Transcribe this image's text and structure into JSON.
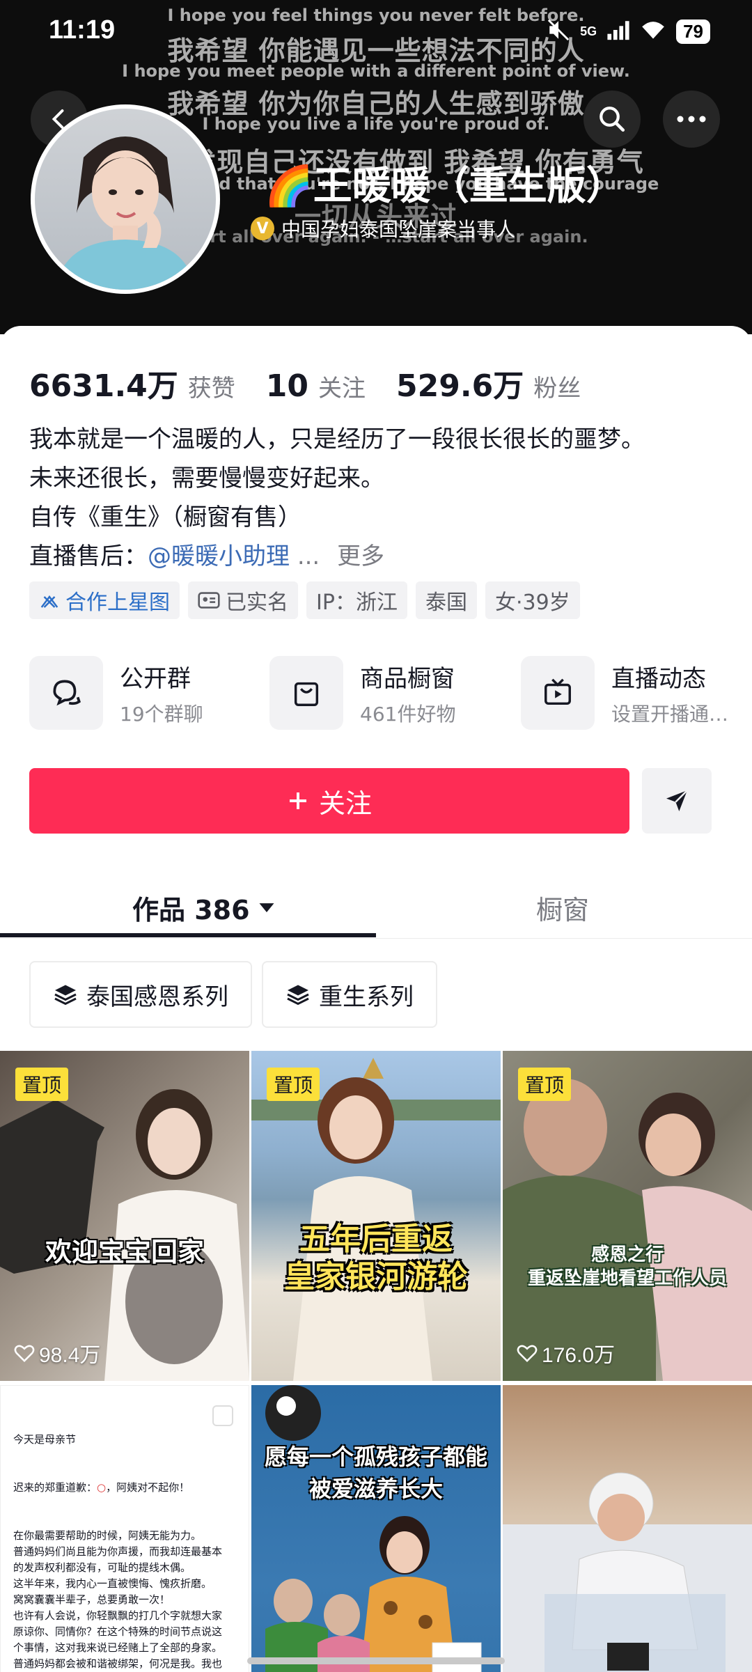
{
  "status_bar": {
    "time": "11:19",
    "network": "5G",
    "battery": "79"
  },
  "banner_subtitles": [
    {
      "cn": "",
      "en": "I hope you feel things you never felt before."
    },
    {
      "cn": "我希望 你能遇见一些想法不同的人",
      "en": "I hope you meet people with a different point of view."
    },
    {
      "cn": "我希望 你为你自己的人生感到骄傲",
      "en": "I hope you live a life you're proud of."
    },
    {
      "cn": "如果你发现自己还没有做到 我希望 你有勇气",
      "en": "And if you find that you're not, I hope you have the courage"
    },
    {
      "cn": "一切从头来过",
      "en": "…start all over again. - …start all over again."
    }
  ],
  "profile": {
    "nickname": "王暖暖（重生版）",
    "rainbow_emoji": "🌈",
    "verification": "中国孕妇泰国坠崖案当事人",
    "verify_badge": "V"
  },
  "stats": [
    {
      "value": "6631.4万",
      "label": "获赞"
    },
    {
      "value": "10",
      "label": "关注"
    },
    {
      "value": "529.6万",
      "label": "粉丝"
    }
  ],
  "bio": {
    "line1": "我本就是一个温暖的人，只是经历了一段很长很长的噩梦。",
    "line2": "未来还很长，需要慢慢变好起来。",
    "line3": "自传《重生》（橱窗有售）",
    "line4_prefix": "直播售后：",
    "line4_link": "@暖暖小助理",
    "line4_ellipsis": "...",
    "more": "更多"
  },
  "tags": [
    "合作上星图",
    "已实名",
    "IP：浙江",
    "泰国",
    "女·39岁"
  ],
  "features": [
    {
      "title": "公开群",
      "sub": "19个群聊",
      "icon": "chat-group-icon"
    },
    {
      "title": "商品橱窗",
      "sub": "461件好物",
      "icon": "shopping-bag-icon"
    },
    {
      "title": "直播动态",
      "sub": "设置开播通…",
      "icon": "tv-icon"
    }
  ],
  "follow_button": "关注",
  "tabs": {
    "works": "作品 386",
    "shop": "橱窗"
  },
  "series": [
    "泰国感恩系列",
    "重生系列"
  ],
  "videos": [
    {
      "pinned": "置顶",
      "caption": "欢迎宝宝回家",
      "likes": "98.4万"
    },
    {
      "pinned": "置顶",
      "caption_line1": "五年后重返",
      "caption_line2": "皇家银河游轮"
    },
    {
      "pinned": "置顶",
      "caption_line1": "感恩之行",
      "caption_line2": "重返坠崖地看望工作人员",
      "likes": "176.0万"
    },
    {
      "letter_title": "今天是母亲节",
      "letter_line1_a": "迟来的郑重道歉：",
      "letter_line1_b": "，阿姨对不起你！",
      "letter_body": "在你最需要帮助的时候，阿姨无能为力。\n普通妈妈们尚且能为你声援，而我却连最基本\n的发声权利都没有，可耻的提线木偶。\n这半年来，我内心一直被懊悔、愧疚折磨。\n窝窝囊囊半辈子，总要勇敢一次！\n也许有人会说，你轻飘飘的打几个字就想大家\n原谅你、同情你？在这个特殊的时间节点说这\n个事情，这对我来说已经赌上了全部的身家。\n普通妈妈都会被和谐被绑架，何况是我。我也\n是一个妈妈，这是我唯一养家糊口的地方，可\n能随时都会再也搜不到我了，这是我能拿出手\n的最大诚意，我只求问心无愧！"
    },
    {
      "caption_line1": "愿每一个孤残孩子都能",
      "caption_line2": "被爱滋养长大"
    },
    {}
  ]
}
